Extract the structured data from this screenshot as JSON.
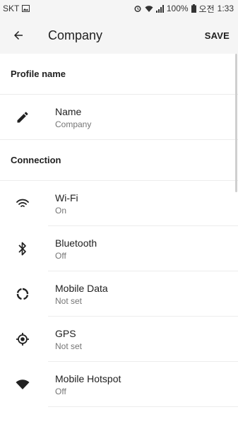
{
  "status_bar": {
    "carrier": "SKT",
    "battery": "100%",
    "time_period": "오전",
    "time": "1:33"
  },
  "appbar": {
    "title": "Company",
    "save_label": "SAVE"
  },
  "profile_section": {
    "header": "Profile name",
    "items": [
      {
        "label": "Name",
        "value": "Company",
        "icon": "edit-pencil-icon"
      }
    ]
  },
  "connection_section": {
    "header": "Connection",
    "items": [
      {
        "label": "Wi-Fi",
        "value": "On",
        "icon": "wifi-icon"
      },
      {
        "label": "Bluetooth",
        "value": "Off",
        "icon": "bluetooth-icon"
      },
      {
        "label": "Mobile Data",
        "value": "Not set",
        "icon": "mobile-data-icon"
      },
      {
        "label": "GPS",
        "value": "Not set",
        "icon": "gps-icon"
      },
      {
        "label": "Mobile Hotspot",
        "value": "Off",
        "icon": "hotspot-icon"
      }
    ]
  }
}
